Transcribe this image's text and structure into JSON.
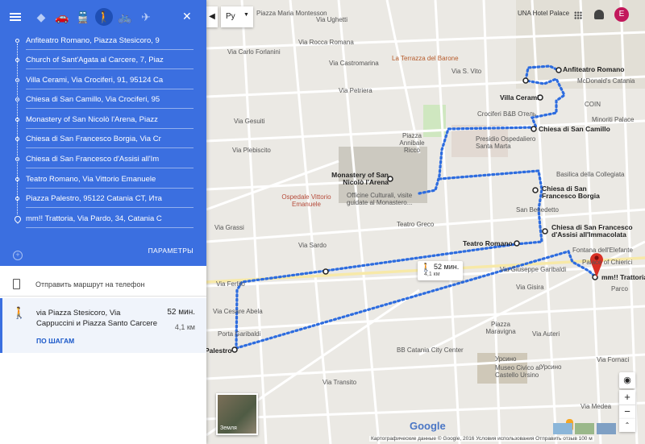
{
  "travel_modes": [
    {
      "name": "best",
      "icon": "diamond-route-icon"
    },
    {
      "name": "drive",
      "icon": "car-icon"
    },
    {
      "name": "transit",
      "icon": "train-icon"
    },
    {
      "name": "walk",
      "icon": "walk-icon"
    },
    {
      "name": "bike",
      "icon": "bike-icon"
    },
    {
      "name": "flight",
      "icon": "plane-icon"
    }
  ],
  "waypoints": [
    "Anfiteatro Romano, Piazza Stesicoro, 9",
    "Church of Sant'Agata al Carcere, 7, Piaz",
    "Villa Cerami, Via Crociferi, 91, 95124 Ca",
    "Chiesa di San Camillo, Via Crociferi, 95",
    "Monastery of San Nicolò l'Arena, Piazz",
    "Chiesa di San Francesco Borgia, Via Cr",
    "Chiesa di San Francesco d'Assisi all'Im",
    "Teatro Romano, Via Vittorio Emanuele",
    "Piazza Palestro, 95122 Catania CT, Ита",
    "mm!! Trattoria, Via Pardo, 34, Catania C"
  ],
  "options_label": "ПАРАМЕТРЫ",
  "send_to_phone": "Отправить маршрут на телефон",
  "route": {
    "via": "via Piazza Stesicoro, Via Cappuccini и Piazza Santo Carcere",
    "duration": "52 мин.",
    "distance": "4,1 км",
    "details": "ПО ШАГАМ"
  },
  "map": {
    "lang_button": "Ру",
    "hotel": "UNA Hotel Palace",
    "avatar_letter": "E",
    "callout_time": "52 мин.",
    "callout_dist": "4,1 км",
    "earth_label": "Земля",
    "google": "Google",
    "footer": "Картографические данные © Google, 2016   Условия использования   Отправить отзыв   100 м",
    "colors": {
      "panel": "#3b6fe0",
      "route": "#2d6cdf",
      "marker": "#d93025",
      "park": "#cfe7c0"
    },
    "places": [
      {
        "id": "amph",
        "text": "Anfiteatro Romano",
        "bold": true
      },
      {
        "id": "cerami",
        "text": "Villa Cerami",
        "bold": true
      },
      {
        "id": "camillo",
        "text": "Chiesa di San Camillo",
        "bold": true
      },
      {
        "id": "monastery",
        "text": "Monastery of San Nicolò l'Arena",
        "bold": true
      },
      {
        "id": "borgia",
        "text": "Chiesa di San Francesco Borgia",
        "bold": true
      },
      {
        "id": "assisi",
        "text": "Chiesa di San Francesco d'Assisi all'Immacolata",
        "bold": true
      },
      {
        "id": "teatro",
        "text": "Teatro Romano",
        "bold": true
      },
      {
        "id": "palestro",
        "text": "Palestro",
        "bold": true
      },
      {
        "id": "trattoria",
        "text": "mm!! Trattoria",
        "bold": true
      },
      {
        "id": "maria",
        "text": "Piazza Maria Montesson"
      },
      {
        "id": "terrazza",
        "text": "La Terrazza del Barone"
      },
      {
        "id": "mcd",
        "text": "McDonald's Catania"
      },
      {
        "id": "coin",
        "text": "COIN"
      },
      {
        "id": "minoriti",
        "text": "Minoriti Palace"
      },
      {
        "id": "crociferi",
        "text": "Crociferi B&B Отель"
      },
      {
        "id": "presidio",
        "text": "Presidio Ospedaliero Santa Marta"
      },
      {
        "id": "annibale",
        "text": "Piazza Annibale Riccò"
      },
      {
        "id": "ospedale",
        "text": "Ospedale Vittorio Emanuele"
      },
      {
        "id": "officine",
        "text": "Officine Culturali, visite guidate al Monastero..."
      },
      {
        "id": "collegiata",
        "text": "Basilica della Collegiata"
      },
      {
        "id": "benedetto",
        "text": "San Benedetto"
      },
      {
        "id": "greco",
        "text": "Teatro Greco"
      },
      {
        "id": "elefante",
        "text": "Fontana dell'Elefante"
      },
      {
        "id": "chierici",
        "text": "Palace of Chierici"
      },
      {
        "id": "parco",
        "text": "Parco"
      },
      {
        "id": "garibaldi",
        "text": "Porta Garibaldi"
      },
      {
        "id": "maravigna",
        "text": "Piazza Maravigna"
      },
      {
        "id": "bb",
        "text": "BB Catania City Center"
      },
      {
        "id": "ursino",
        "text": "Урсино"
      },
      {
        "id": "castello",
        "text": "Museo Civico al Castello Ursino"
      },
      {
        "id": "ursino2",
        "text": "Урсино"
      },
      {
        "id": "via_ughetti",
        "text": "Via Ughetti"
      },
      {
        "id": "via_rocca",
        "text": "Via Rocca Romana"
      },
      {
        "id": "via_castro",
        "text": "Via Castromarina"
      },
      {
        "id": "via_petriera",
        "text": "Via Petriera"
      },
      {
        "id": "via_svito",
        "text": "Via S. Vito"
      },
      {
        "id": "via_gesuiti",
        "text": "Via Gesuiti"
      },
      {
        "id": "via_plebiscito",
        "text": "Via Plebiscito"
      },
      {
        "id": "via_grassi",
        "text": "Via Grassi"
      },
      {
        "id": "via_sardo",
        "text": "Via Sardo"
      },
      {
        "id": "via_ferlito",
        "text": "Via Ferlito"
      },
      {
        "id": "via_abela",
        "text": "Via Cesare Abela"
      },
      {
        "id": "via_gisira",
        "text": "Via Gisira"
      },
      {
        "id": "via_garibaldi",
        "text": "Via Giuseppe Garibaldi"
      },
      {
        "id": "via_transito",
        "text": "Via Transito"
      },
      {
        "id": "via_auteri",
        "text": "Via Auteri"
      },
      {
        "id": "via_fornaci",
        "text": "Via Fornaci"
      },
      {
        "id": "via_carlo",
        "text": "Via Carlo Forlanini"
      },
      {
        "id": "via_medea",
        "text": "Via Medea"
      }
    ]
  }
}
